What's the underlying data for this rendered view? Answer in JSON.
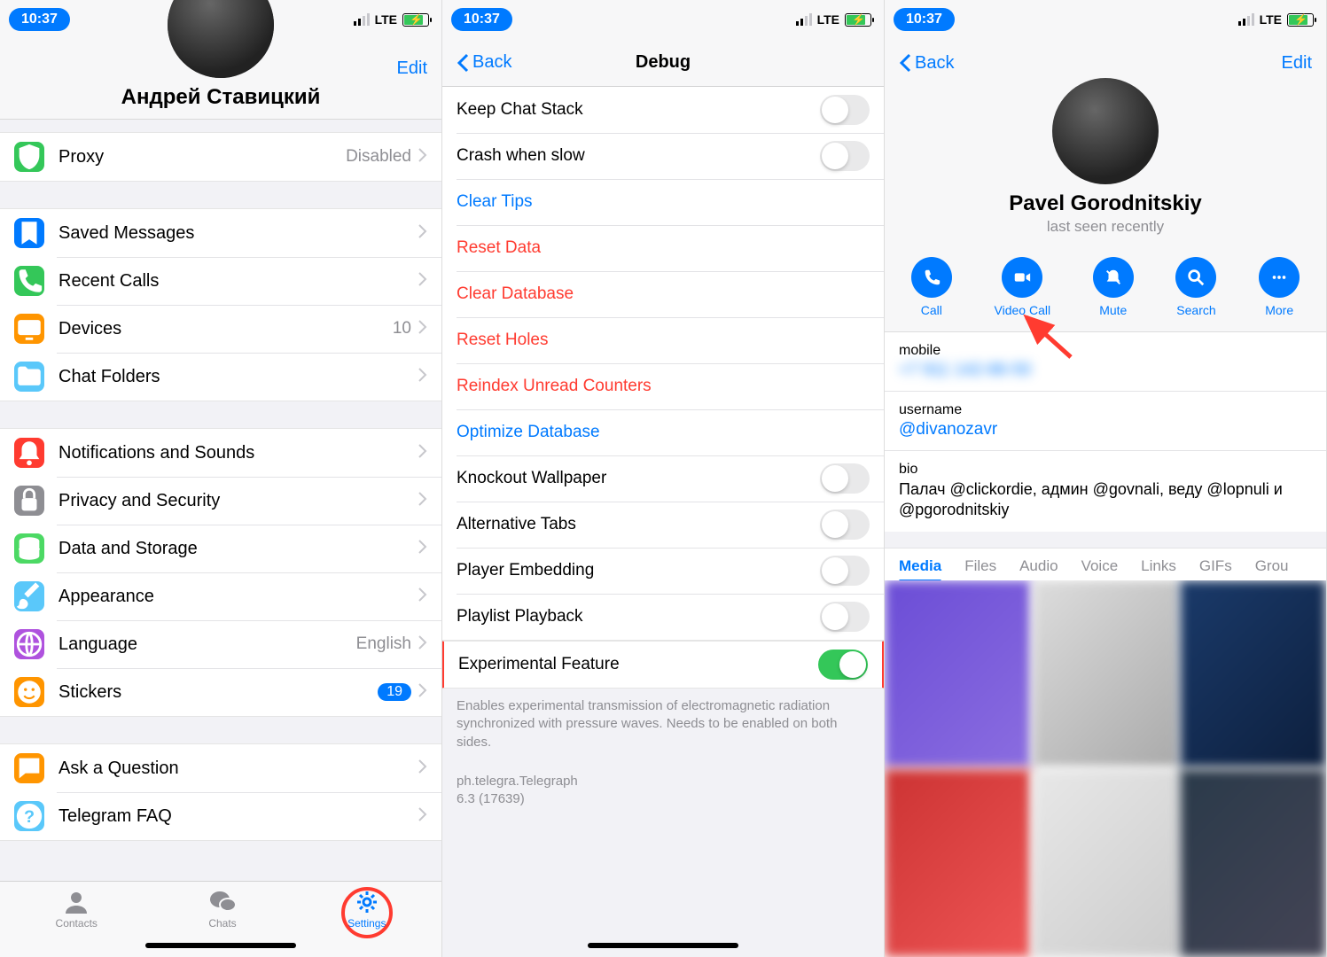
{
  "status": {
    "time": "10:37",
    "net": "LTE"
  },
  "screen1": {
    "name": "Андрей Ставицкий",
    "edit": "Edit",
    "rows": {
      "proxy": {
        "label": "Proxy",
        "value": "Disabled"
      },
      "saved": {
        "label": "Saved Messages"
      },
      "recent": {
        "label": "Recent Calls"
      },
      "devices": {
        "label": "Devices",
        "value": "10"
      },
      "folders": {
        "label": "Chat Folders"
      },
      "notif": {
        "label": "Notifications and Sounds"
      },
      "privacy": {
        "label": "Privacy and Security"
      },
      "data": {
        "label": "Data and Storage"
      },
      "appearance": {
        "label": "Appearance"
      },
      "language": {
        "label": "Language",
        "value": "English"
      },
      "stickers": {
        "label": "Stickers",
        "badge": "19"
      },
      "ask": {
        "label": "Ask a Question"
      },
      "faq": {
        "label": "Telegram FAQ"
      }
    },
    "tabs": {
      "contacts": "Contacts",
      "chats": "Chats",
      "settings": "Settings"
    }
  },
  "screen2": {
    "back": "Back",
    "title": "Debug",
    "rows": {
      "keep_stack": "Keep Chat Stack",
      "crash_slow": "Crash when slow",
      "clear_tips": "Clear Tips",
      "reset_data": "Reset Data",
      "clear_db": "Clear Database",
      "reset_holes": "Reset Holes",
      "reindex": "Reindex Unread Counters",
      "optimize": "Optimize Database",
      "knockout": "Knockout Wallpaper",
      "alt_tabs": "Alternative Tabs",
      "player_embed": "Player Embedding",
      "playlist": "Playlist Playback",
      "experimental": "Experimental Feature"
    },
    "exp_desc": "Enables experimental transmission of electromagnetic radiation synchronized with pressure waves. Needs to be enabled on both sides.",
    "bundle": "ph.telegra.Telegraph",
    "version": "6.3 (17639)"
  },
  "screen3": {
    "back": "Back",
    "edit": "Edit",
    "name": "Pavel Gorodnitskiy",
    "status": "last seen recently",
    "actions": {
      "call": "Call",
      "video": "Video Call",
      "mute": "Mute",
      "search": "Search",
      "more": "More"
    },
    "mobile_label": "mobile",
    "mobile_value": "+7 911 142-86-50",
    "user_label": "username",
    "user_value": "@divanozavr",
    "bio_label": "bio",
    "bio_value": "Палач @clickordie, админ @govnali, веду @lopnuli и @pgorodnitskiy",
    "tabs": {
      "media": "Media",
      "files": "Files",
      "audio": "Audio",
      "voice": "Voice",
      "links": "Links",
      "gifs": "GIFs",
      "groups": "Grou"
    }
  }
}
